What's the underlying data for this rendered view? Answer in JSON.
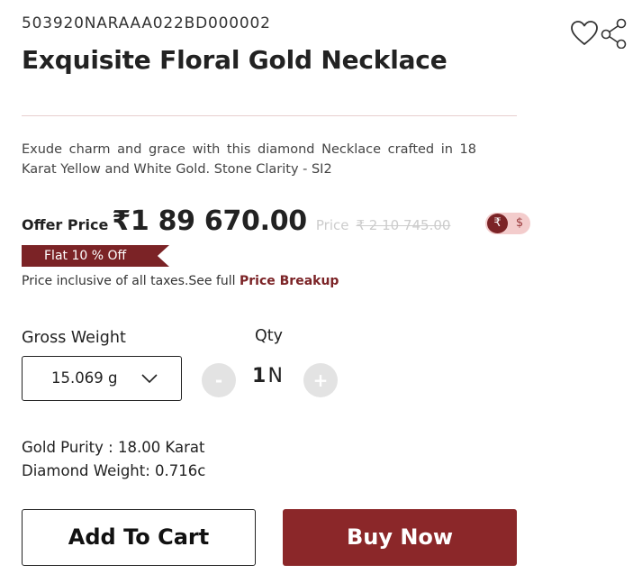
{
  "product": {
    "sku": "503920NARAAA022BD000002",
    "title": "Exquisite Floral Gold Necklace",
    "description": "Exude charm and grace with this diamond Necklace crafted in 18 Karat Yellow and White Gold. Stone Clarity - SI2"
  },
  "pricing": {
    "offer_label": "Offer Price",
    "offer_price": "₹1 89 670.00",
    "original_label": "Price",
    "original_price": "₹ 2 10 745.00",
    "discount_tag": "Flat 10 % Off",
    "tax_note": "Price inclusive of all taxes.See full ",
    "breakup_link": "Price Breakup"
  },
  "currency_toggle": {
    "inr_symbol": "₹",
    "usd_symbol": "$",
    "selected": "INR"
  },
  "gross_weight": {
    "label": "Gross Weight",
    "value": "15.069 g"
  },
  "quantity": {
    "label": "Qty",
    "minus": "-",
    "plus": "+",
    "value": "1",
    "unit": "N"
  },
  "specs": {
    "gold_purity": "Gold Purity : 18.00 Karat",
    "diamond_weight": "Diamond Weight: 0.716c"
  },
  "actions": {
    "add_to_cart": "Add To Cart",
    "buy_now": "Buy Now"
  },
  "icons": {
    "wishlist": "heart-icon",
    "share": "share-icon",
    "dropdown": "chevron-down-icon"
  },
  "colors": {
    "brand": "#8b2729",
    "brand_dark": "#7b2326",
    "toggle_bg": "#f3cccc",
    "qty_button_bg": "#e3e3e3"
  }
}
